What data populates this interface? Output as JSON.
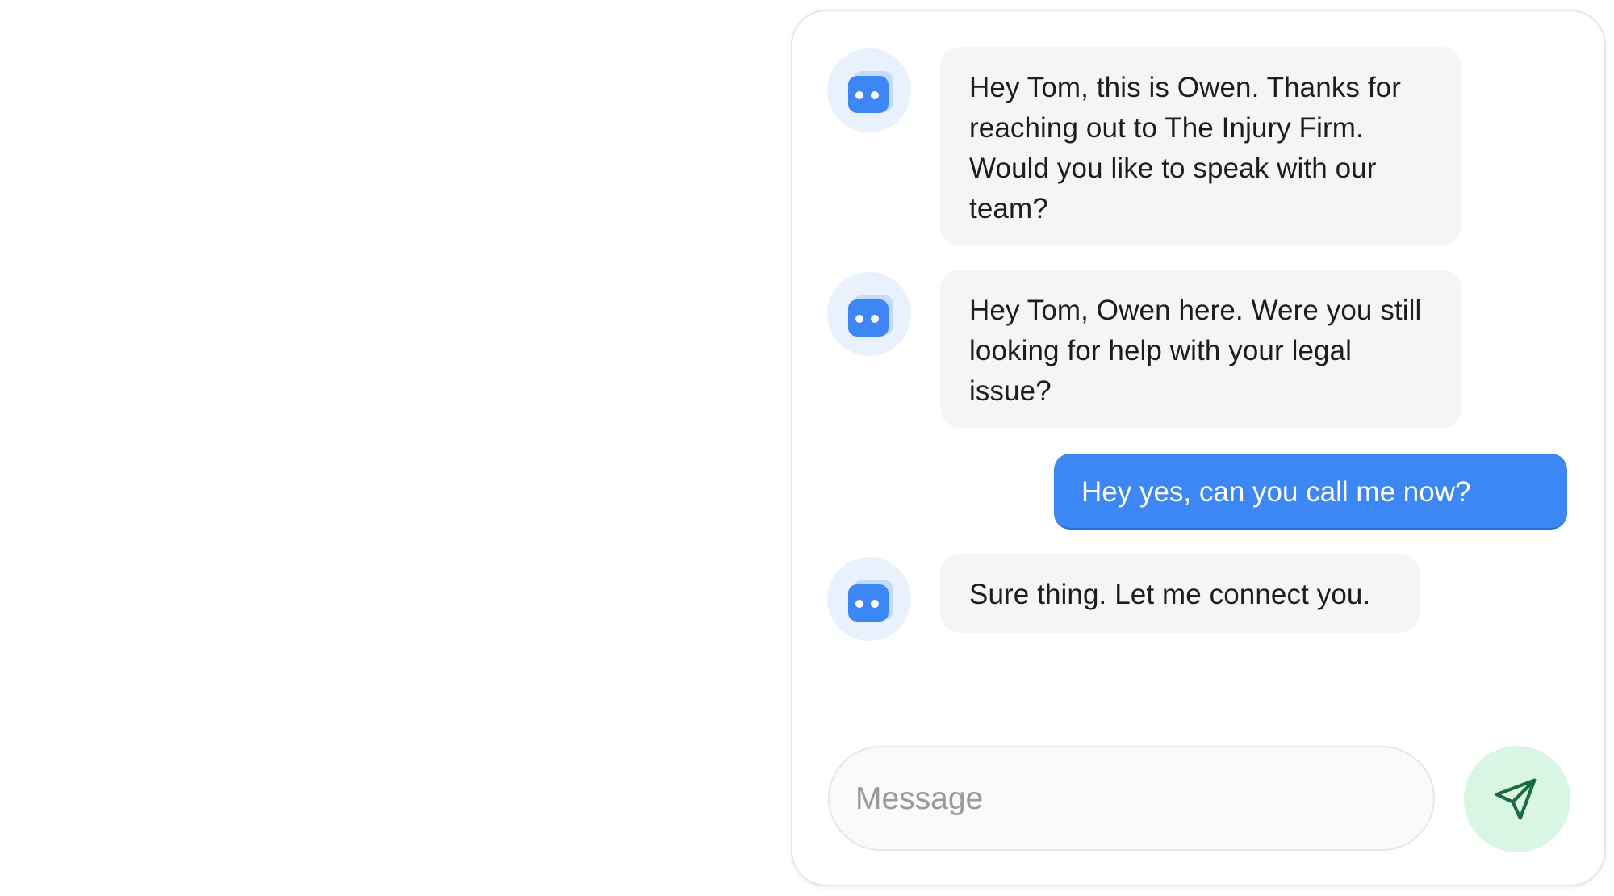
{
  "messages": [
    {
      "sender": "bot",
      "text": "Hey Tom, this is Owen. Thanks for reaching out to The Injury Firm. Would you like to speak with our team?"
    },
    {
      "sender": "bot",
      "text": "Hey Tom, Owen here. Were you still looking for help with your legal issue?"
    },
    {
      "sender": "user",
      "text": "Hey yes, can you call me now?"
    },
    {
      "sender": "bot",
      "text": "Sure thing. Let me connect you."
    }
  ],
  "composer": {
    "placeholder": "Message",
    "value": ""
  },
  "icons": {
    "avatar": "bot-avatar-icon",
    "send": "send-paper-plane-icon"
  },
  "colors": {
    "user_bubble": "#3d87f5",
    "bot_bubble": "#f5f5f5",
    "avatar_bg": "#e8f1fc",
    "avatar_icon": "#3d87f5",
    "send_bg": "#d9f5e4",
    "send_icon": "#1a6b3a"
  }
}
